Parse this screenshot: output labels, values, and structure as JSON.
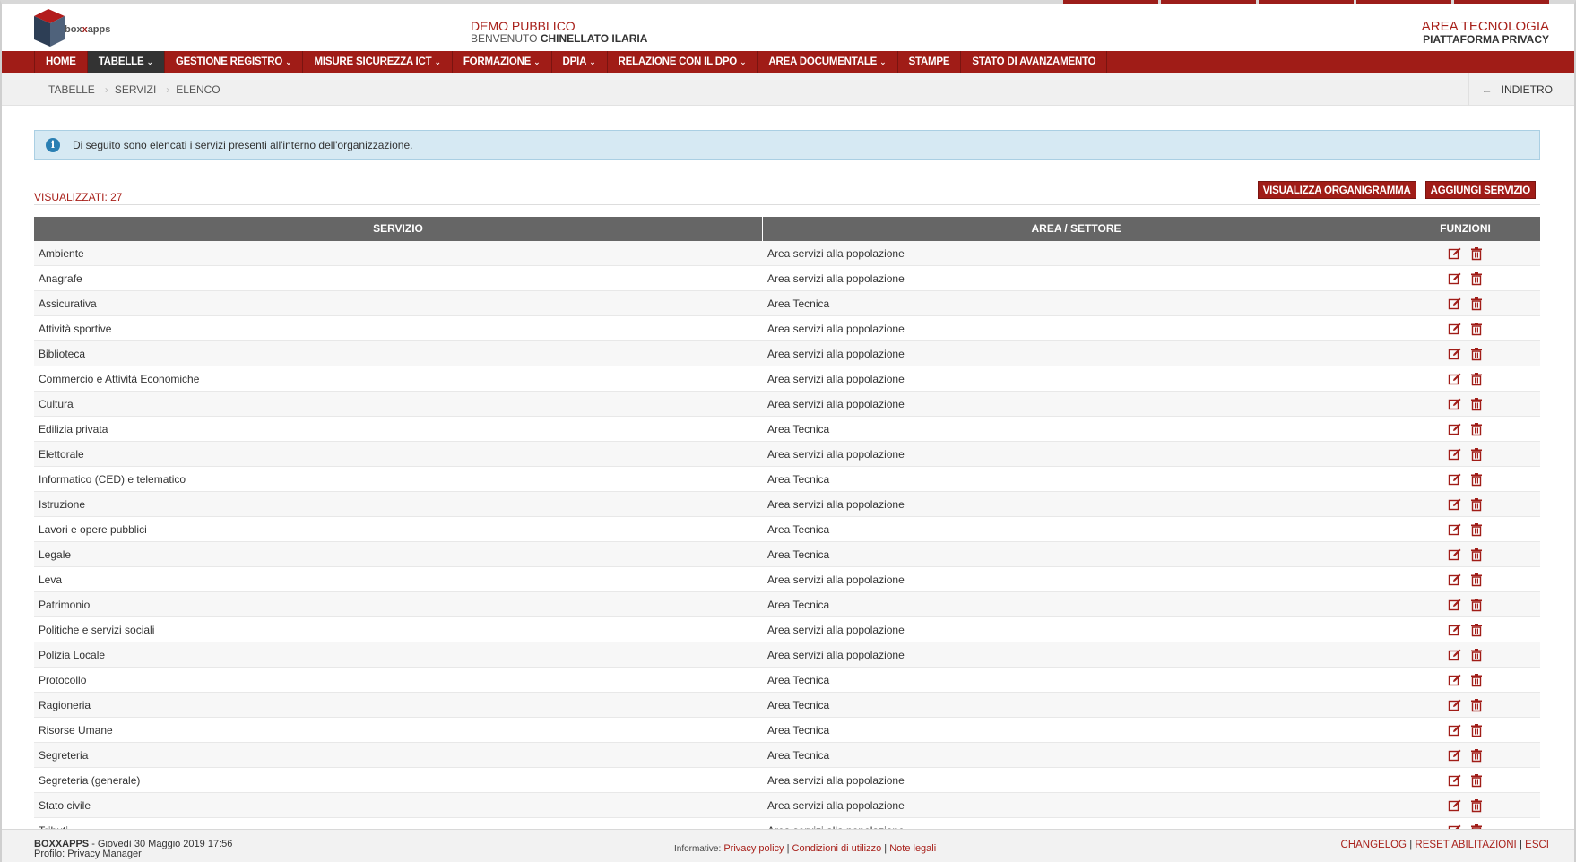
{
  "header": {
    "logo_text_a": "box",
    "logo_text_b": "x",
    "logo_text_c": "apps",
    "org": "DEMO PUBBLICO",
    "welcome_prefix": "BENVENUTO",
    "user": "CHINELLATO ILARIA",
    "area": "AREA TECNOLOGIA",
    "platform": "PIATTAFORMA PRIVACY"
  },
  "nav": {
    "items": [
      {
        "label": "HOME",
        "caret": ""
      },
      {
        "label": "TABELLE",
        "caret": "⌄"
      },
      {
        "label": "GESTIONE REGISTRO",
        "caret": "⌄"
      },
      {
        "label": "MISURE SICUREZZA ICT",
        "caret": "⌄"
      },
      {
        "label": "FORMAZIONE",
        "caret": "⌄"
      },
      {
        "label": "DPIA",
        "caret": "⌄"
      },
      {
        "label": "RELAZIONE CON IL DPO",
        "caret": "⌄"
      },
      {
        "label": "AREA DOCUMENTALE",
        "caret": "⌄"
      },
      {
        "label": "STAMPE",
        "caret": ""
      },
      {
        "label": "STATO DI AVANZAMENTO",
        "caret": ""
      }
    ]
  },
  "breadcrumb": [
    "TABELLE",
    "SERVIZI",
    "ELENCO"
  ],
  "back": {
    "arrow": "←",
    "label": "INDIETRO"
  },
  "info": {
    "icon": "i",
    "text": "Di seguito sono elencati i servizi presenti all'interno dell'organizzazione."
  },
  "toolbar": {
    "count_label": "VISUALIZZATI: 27",
    "org_chart_button": "VISUALIZZA ORGANIGRAMMA",
    "add_button": "AGGIUNGI SERVIZIO"
  },
  "table": {
    "headers": [
      "SERVIZIO",
      "AREA / SETTORE",
      "FUNZIONI"
    ],
    "rows": [
      [
        "Ambiente",
        "Area servizi alla popolazione"
      ],
      [
        "Anagrafe",
        "Area servizi alla popolazione"
      ],
      [
        "Assicurativa",
        "Area Tecnica"
      ],
      [
        "Attività sportive",
        "Area servizi alla popolazione"
      ],
      [
        "Biblioteca",
        "Area servizi alla popolazione"
      ],
      [
        "Commercio e Attività Economiche",
        "Area servizi alla popolazione"
      ],
      [
        "Cultura",
        "Area servizi alla popolazione"
      ],
      [
        "Edilizia privata",
        "Area Tecnica"
      ],
      [
        "Elettorale",
        "Area servizi alla popolazione"
      ],
      [
        "Informatico (CED) e telematico",
        "Area Tecnica"
      ],
      [
        "Istruzione",
        "Area servizi alla popolazione"
      ],
      [
        "Lavori e opere pubblici",
        "Area Tecnica"
      ],
      [
        "Legale",
        "Area Tecnica"
      ],
      [
        "Leva",
        "Area servizi alla popolazione"
      ],
      [
        "Patrimonio",
        "Area Tecnica"
      ],
      [
        "Politiche e servizi sociali",
        "Area servizi alla popolazione"
      ],
      [
        "Polizia Locale",
        "Area servizi alla popolazione"
      ],
      [
        "Protocollo",
        "Area Tecnica"
      ],
      [
        "Ragioneria",
        "Area Tecnica"
      ],
      [
        "Risorse Umane",
        "Area Tecnica"
      ],
      [
        "Segreteria",
        "Area Tecnica"
      ],
      [
        "Segreteria (generale)",
        "Area servizi alla popolazione"
      ],
      [
        "Stato civile",
        "Area servizi alla popolazione"
      ],
      [
        "Tributi",
        "Area servizi alla popolazione"
      ]
    ]
  },
  "footer": {
    "brand": "BOXXAPPS",
    "date": " - Giovedì 30 Maggio 2019 17:56",
    "profile": "Profilo: Privacy Manager",
    "informative_label": "Informative:",
    "privacy": "Privacy policy",
    "conditions": "Condizioni di utilizzo",
    "legal": "Note legali",
    "sep": "|",
    "changelog": "CHANGELOG",
    "reset": "RESET ABILITAZIONI",
    "exit": "ESCI"
  },
  "colors": {
    "brand_red": "#a01c17",
    "active_nav": "#333333",
    "table_header": "#666666",
    "info_bg": "#d6e9f3"
  }
}
